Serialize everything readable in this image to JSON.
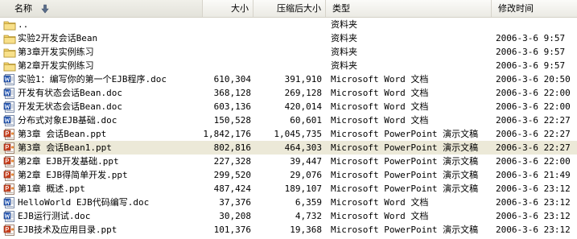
{
  "header": {
    "name": "名称",
    "size": "大小",
    "compressed": "压缩后大小",
    "type": "类型",
    "modified": "修改时间"
  },
  "rows": [
    {
      "icon": "folder-up-icon",
      "name": "..",
      "size": "",
      "csize": "",
      "type": "资料夹",
      "date": ""
    },
    {
      "icon": "folder-icon",
      "name": "实验2开发会话Bean",
      "size": "",
      "csize": "",
      "type": "资料夹",
      "date": "2006-3-6 9:57"
    },
    {
      "icon": "folder-icon",
      "name": "第3章开发实例练习",
      "size": "",
      "csize": "",
      "type": "资料夹",
      "date": "2006-3-6 9:57"
    },
    {
      "icon": "folder-icon",
      "name": "第2章开发实例练习",
      "size": "",
      "csize": "",
      "type": "资料夹",
      "date": "2006-3-6 9:57"
    },
    {
      "icon": "word-icon",
      "name": "实验1：编写你的第一个EJB程序.doc",
      "size": "610,304",
      "csize": "391,910",
      "type": "Microsoft Word 文档",
      "date": "2006-3-6 20:50"
    },
    {
      "icon": "word-icon",
      "name": "开发有状态会话Bean.doc",
      "size": "368,128",
      "csize": "269,128",
      "type": "Microsoft Word 文档",
      "date": "2006-3-6 22:00"
    },
    {
      "icon": "word-icon",
      "name": "开发无状态会话Bean.doc",
      "size": "603,136",
      "csize": "420,014",
      "type": "Microsoft Word 文档",
      "date": "2006-3-6 22:00"
    },
    {
      "icon": "word-icon",
      "name": "分布式对象EJB基础.doc",
      "size": "150,528",
      "csize": "60,601",
      "type": "Microsoft Word 文档",
      "date": "2006-3-6 22:27"
    },
    {
      "icon": "powerpoint-icon",
      "name": "第3章 会话Bean.ppt",
      "size": "1,842,176",
      "csize": "1,045,735",
      "type": "Microsoft PowerPoint 演示文稿",
      "date": "2006-3-6 22:27"
    },
    {
      "icon": "powerpoint-icon",
      "name": "第3章 会话Bean1.ppt",
      "size": "802,816",
      "csize": "464,303",
      "type": "Microsoft PowerPoint 演示文稿",
      "date": "2006-3-6 22:27",
      "selected": true
    },
    {
      "icon": "powerpoint-icon",
      "name": "第2章 EJB开发基础.ppt",
      "size": "227,328",
      "csize": "39,447",
      "type": "Microsoft PowerPoint 演示文稿",
      "date": "2006-3-6 22:00"
    },
    {
      "icon": "powerpoint-icon",
      "name": "第2章 EJB得简单开发.ppt",
      "size": "299,520",
      "csize": "29,076",
      "type": "Microsoft PowerPoint 演示文稿",
      "date": "2006-3-6 21:49"
    },
    {
      "icon": "powerpoint-icon",
      "name": "第1章 概述.ppt",
      "size": "487,424",
      "csize": "189,107",
      "type": "Microsoft PowerPoint 演示文稿",
      "date": "2006-3-6 23:12"
    },
    {
      "icon": "word-icon",
      "name": "HelloWorld EJB代码编写.doc",
      "size": "37,376",
      "csize": "6,359",
      "type": "Microsoft Word 文档",
      "date": "2006-3-6 23:12"
    },
    {
      "icon": "word-icon",
      "name": "EJB运行测试.doc",
      "size": "30,208",
      "csize": "4,732",
      "type": "Microsoft Word 文档",
      "date": "2006-3-6 23:12"
    },
    {
      "icon": "powerpoint-icon",
      "name": "EJB技术及应用目录.ppt",
      "size": "101,376",
      "csize": "19,368",
      "type": "Microsoft PowerPoint 演示文稿",
      "date": "2006-3-6 23:12"
    }
  ]
}
